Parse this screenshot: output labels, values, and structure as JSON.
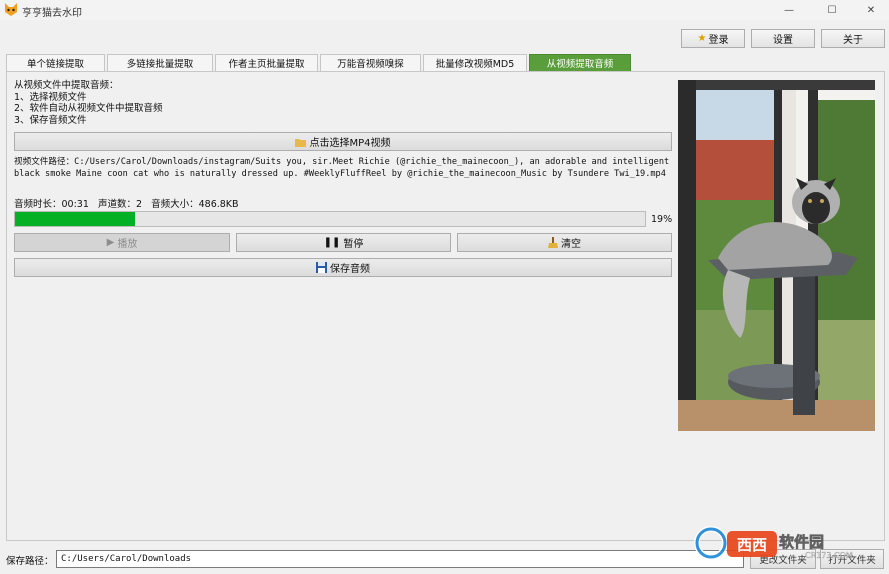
{
  "window": {
    "title": "亨亨猫去水印",
    "controls": {
      "minimize": "—",
      "maximize": "☐",
      "close": "✕"
    }
  },
  "toolbar": {
    "login_label": "登录",
    "settings_label": "设置",
    "about_label": "关于"
  },
  "tabs": [
    {
      "label": "单个链接提取"
    },
    {
      "label": "多链接批量提取"
    },
    {
      "label": "作者主页批量提取"
    },
    {
      "label": "万能音视频嗅探"
    },
    {
      "label": "批量修改视频MD5"
    },
    {
      "label": "从视频提取音频",
      "active": true
    }
  ],
  "instructions": {
    "heading": "从视频文件中提取音频：",
    "steps": [
      "1、选择视频文件",
      "2、软件自动从视频文件中提取音频",
      "3、保存音频文件"
    ]
  },
  "select_button": {
    "label": "点击选择MP4视频"
  },
  "file_path": {
    "label": "视频文件路径：",
    "value": "C:/Users/Carol/Downloads/instagram/Suits you, sir.Meet Richie (@richie_the_mainecoon_), an adorable and intelligent black smoke Maine coon cat who is naturally dressed up. #WeeklyFluffReel by @richie_the_mainecoon_Music by Tsundere Twi_19.mp4"
  },
  "audio_info": {
    "duration_label": "音频时长：",
    "duration": "00:31",
    "channels_label": "声道数：",
    "channels": "2",
    "size_label": "音频大小：",
    "size": "486.8KB"
  },
  "progress": {
    "value": 0.19,
    "label": "19%"
  },
  "controls": {
    "play_label": "播放",
    "pause_label": "暂停",
    "clear_label": "清空",
    "save_label": "保存音频"
  },
  "footer": {
    "save_path_label": "保存路径：",
    "save_path": "C:/Users/Carol/Downloads",
    "change_folder_label": "更改文件夹",
    "open_folder_label": "打开文件夹"
  },
  "watermark": {
    "brand": "西西软件园",
    "url": "CR173.COM"
  },
  "icons": {
    "app": "cat-icon",
    "login": "star-icon",
    "select": "folder-icon",
    "play": "play-icon",
    "pause": "pause-icon",
    "clear": "broom-icon",
    "save": "floppy-icon"
  },
  "colors": {
    "active_tab": "#5a9e3c",
    "progress": "#06b025",
    "watermark": "#e8461c"
  }
}
